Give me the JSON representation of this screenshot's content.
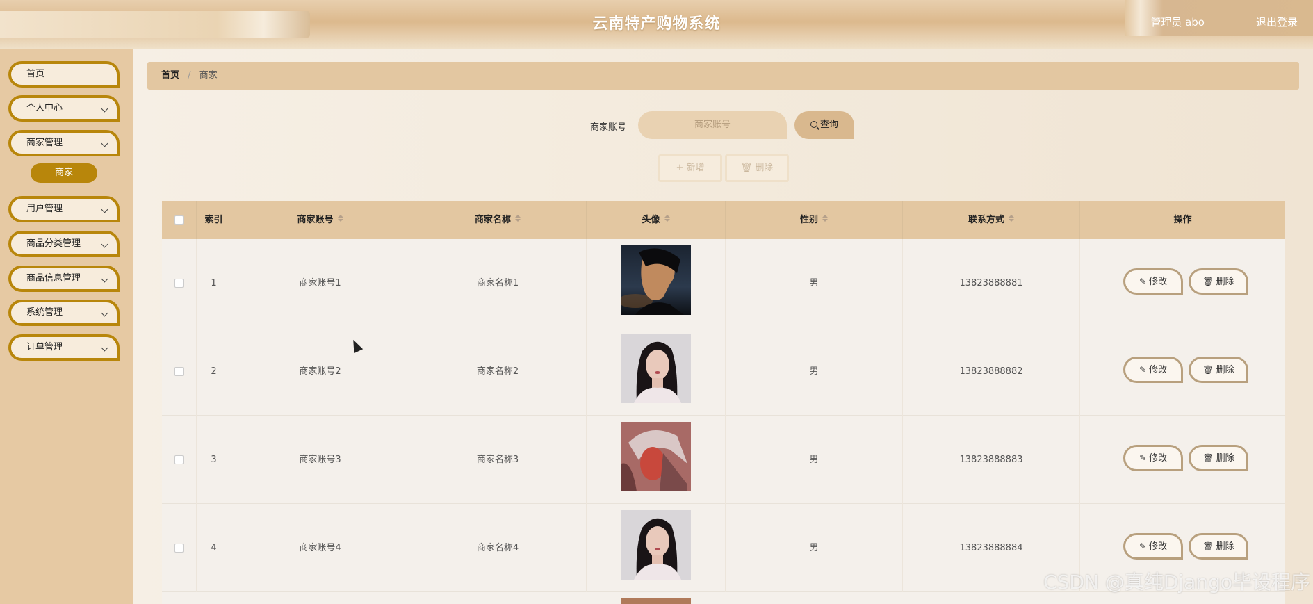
{
  "header": {
    "title": "云南特产购物系统",
    "user": "管理员 abo",
    "logout": "退出登录"
  },
  "sidebar": {
    "items": [
      {
        "label": "首页"
      },
      {
        "label": "个人中心"
      },
      {
        "label": "商家管理"
      },
      {
        "label": "用户管理"
      },
      {
        "label": "商品分类管理"
      },
      {
        "label": "商品信息管理"
      },
      {
        "label": "系统管理"
      },
      {
        "label": "订单管理"
      }
    ],
    "sub_active": "商家"
  },
  "breadcrumb": {
    "home": "首页",
    "separator": "/",
    "current": "商家"
  },
  "search": {
    "label": "商家账号",
    "placeholder": "商家账号",
    "button": "查询"
  },
  "actions": {
    "add": "新增",
    "delete": "删除"
  },
  "table": {
    "headers": [
      "索引",
      "商家账号",
      "商家名称",
      "头像",
      "性别",
      "联系方式",
      "操作"
    ],
    "rows": [
      {
        "index": "1",
        "account": "商家账号1",
        "name": "商家名称1",
        "gender": "男",
        "phone": "13823888881"
      },
      {
        "index": "2",
        "account": "商家账号2",
        "name": "商家名称2",
        "gender": "男",
        "phone": "13823888882"
      },
      {
        "index": "3",
        "account": "商家账号3",
        "name": "商家名称3",
        "gender": "男",
        "phone": "13823888883"
      },
      {
        "index": "4",
        "account": "商家账号4",
        "name": "商家名称4",
        "gender": "男",
        "phone": "13823888884"
      }
    ],
    "edit_label": "修改",
    "delete_label": "删除"
  },
  "colors": {
    "accent": "#b8860b",
    "header_bg": "#e3c7a1",
    "sidebar_bg": "#e6c9a3"
  },
  "watermark": "CSDN @真纯Django毕设程序"
}
